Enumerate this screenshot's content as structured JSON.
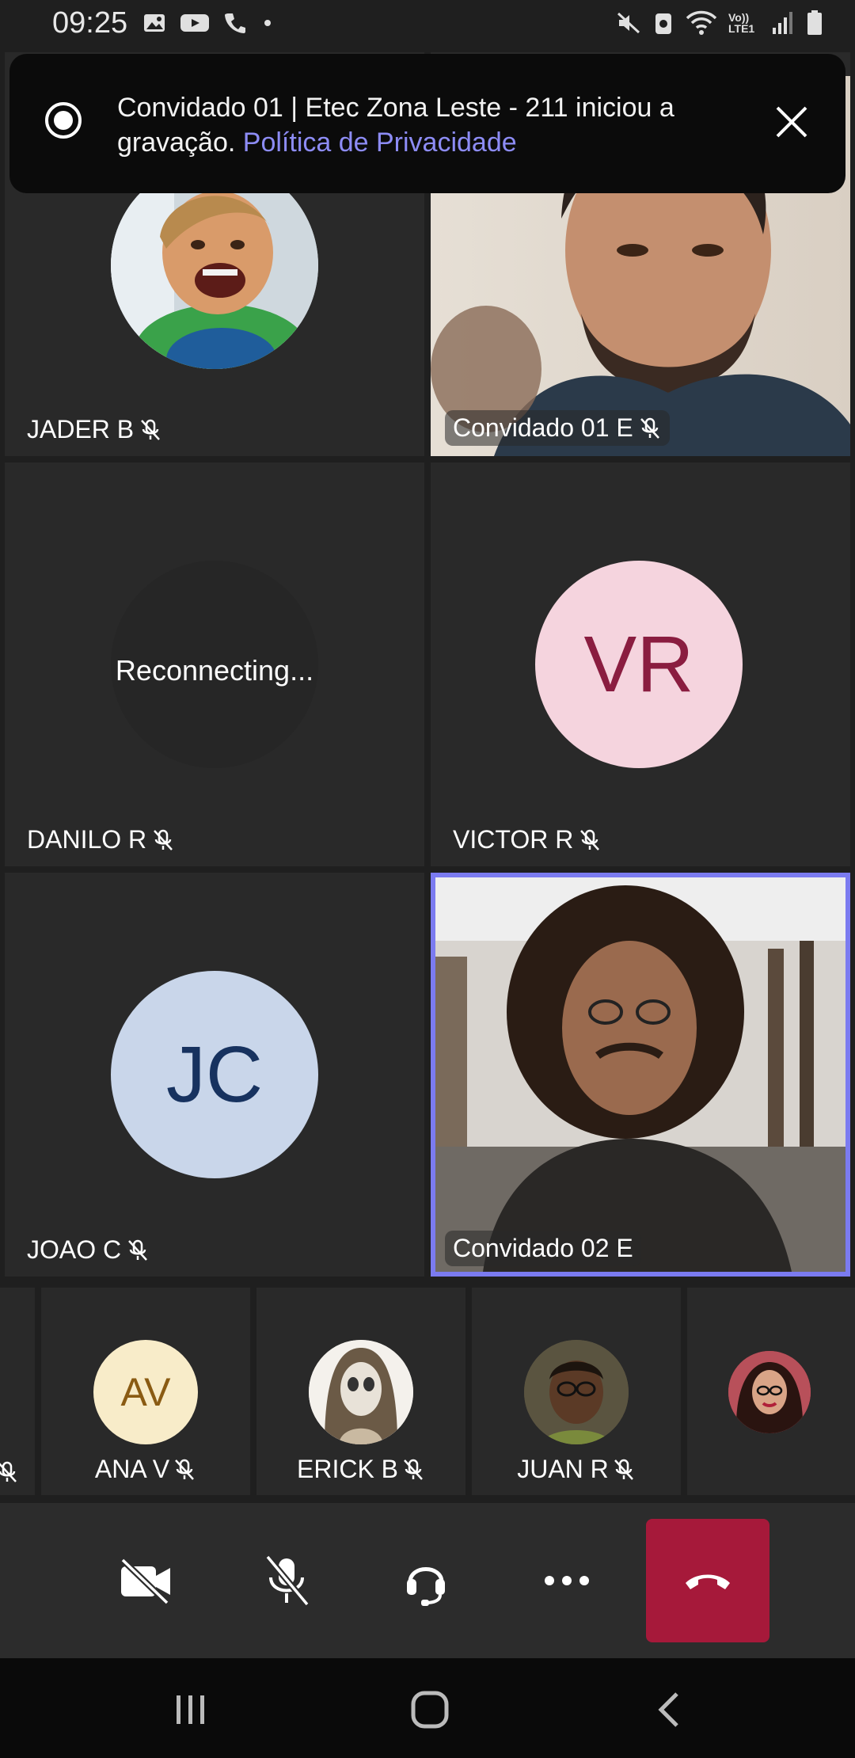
{
  "status_bar": {
    "time": "09:25",
    "icons": [
      "gallery-icon",
      "youtube-icon",
      "phone-icon",
      "dot-icon",
      "mute-icon",
      "data-saver-icon",
      "wifi-icon",
      "volte-icon",
      "signal-icon",
      "battery-icon"
    ],
    "volte_label": "Vo)) LTE1"
  },
  "banner": {
    "message": "Convidado 01 | Etec Zona Leste - 211 iniciou a gravação.",
    "link": "Política de Privacidade",
    "link_color": "#8d8cf5"
  },
  "tiles": [
    {
      "name": "JADER B",
      "muted": true
    },
    {
      "name": "Convidado 01 E",
      "muted": true
    },
    {
      "name": "DANILO R",
      "muted": true,
      "status": "Reconnecting..."
    },
    {
      "name": "VICTOR R",
      "muted": true,
      "initials": "VR",
      "avatar_bg": "#f5d4de",
      "avatar_fg": "#8a1d40"
    },
    {
      "name": "JOAO C",
      "muted": true,
      "initials": "JC",
      "avatar_bg": "#c9d6ea",
      "avatar_fg": "#17325f"
    },
    {
      "name": "Convidado 02 E",
      "muted": false,
      "active_speaker": true
    }
  ],
  "strip": [
    {
      "name": "ANA V",
      "initials": "AV",
      "muted": true,
      "avatar_bg": "#f8ecc9",
      "avatar_fg": "#8a5b13"
    },
    {
      "name": "ERICK B",
      "muted": true
    },
    {
      "name": "JUAN R",
      "muted": true
    },
    {
      "name": "",
      "muted": false
    }
  ],
  "controls": [
    "camera-off-icon",
    "mic-off-icon",
    "headset-icon",
    "more-icon",
    "hang-up-icon"
  ],
  "colors": {
    "active_speaker_border": "#7b7bf0",
    "hangup": "#a6193a",
    "background": "#1f1f1f",
    "tile": "#292929"
  }
}
